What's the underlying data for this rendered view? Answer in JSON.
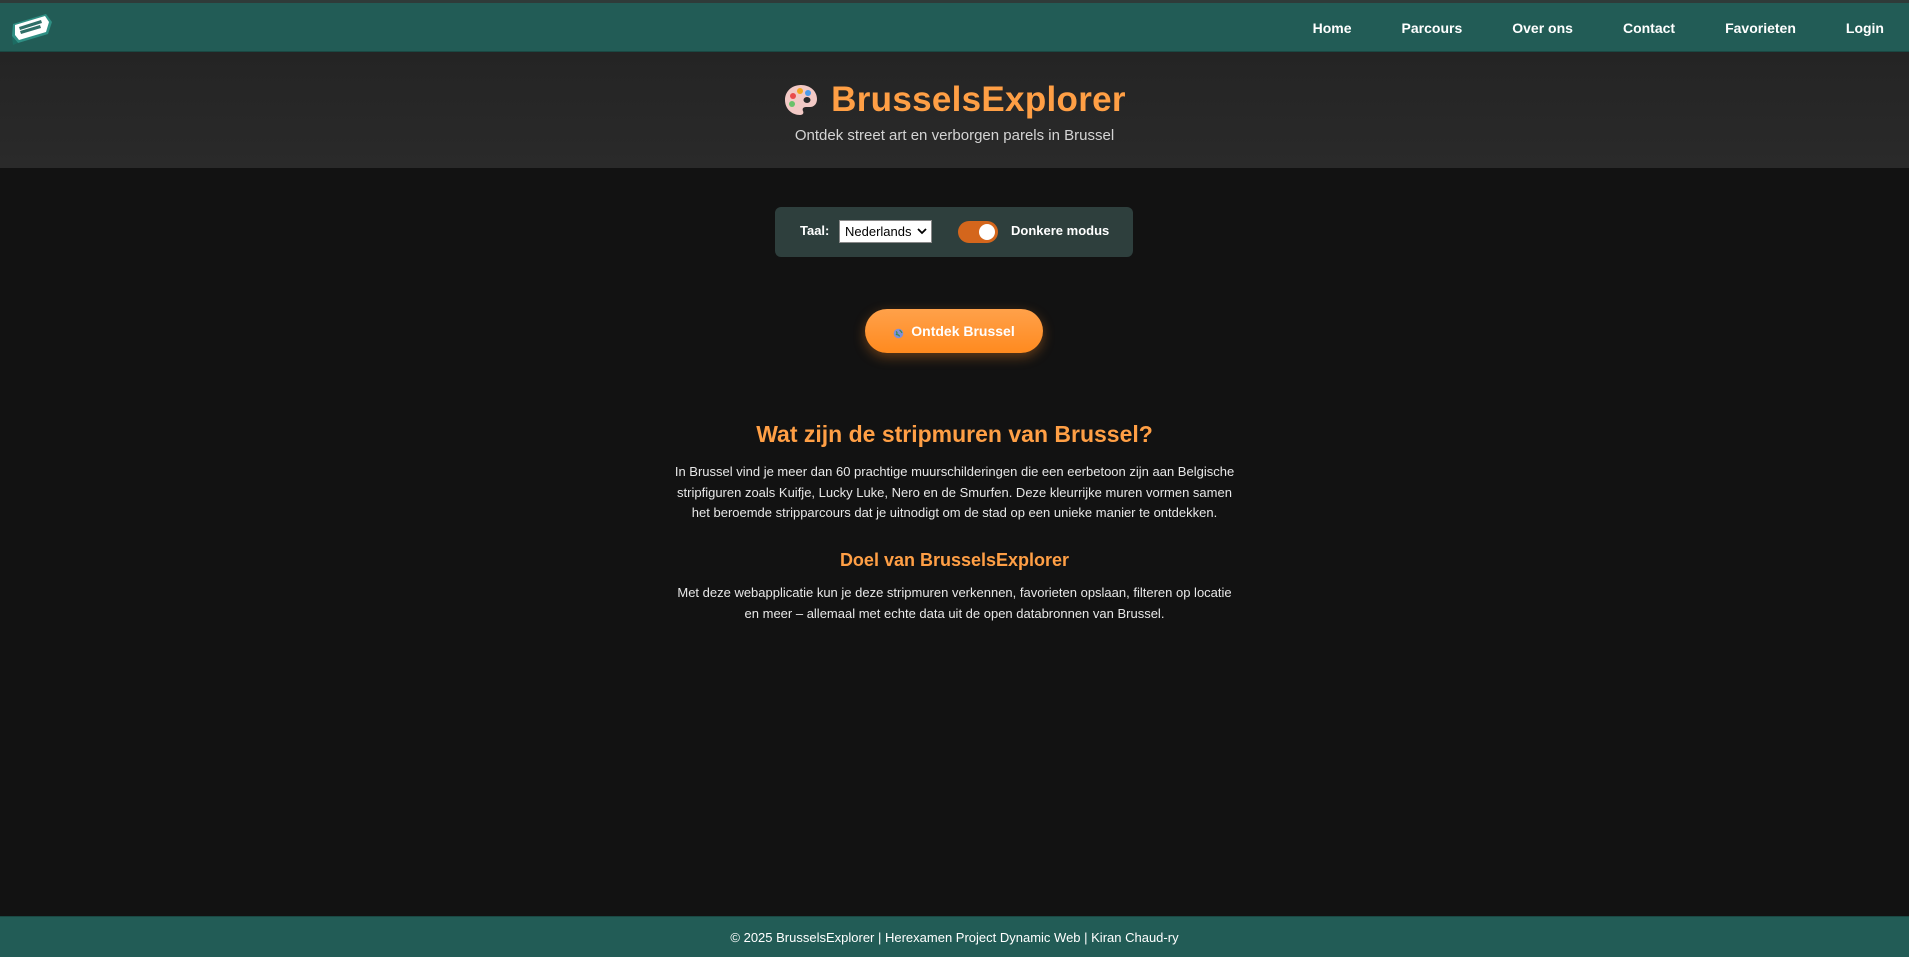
{
  "nav": {
    "logo_alt": "logo-icon",
    "links": [
      "Home",
      "Parcours",
      "Over ons",
      "Contact",
      "Favorieten",
      "Login"
    ]
  },
  "header": {
    "title": "BrusselsExplorer",
    "subtitle": "Ontdek street art en verborgen parels in Brussel",
    "icon": "palette-icon"
  },
  "settings": {
    "language_label": "Taal:",
    "language_selected": "Nederlands",
    "dark_mode_label": "Donkere modus",
    "dark_mode_on": true
  },
  "cta": {
    "label": "Ontdek Brussel",
    "icon": "globe-icon"
  },
  "content": {
    "heading": "Wat zijn de stripmuren van Brussel?",
    "intro": "In Brussel vind je meer dan 60 prachtige muurschilderingen die een eerbetoon zijn aan Belgische stripfiguren zoals Kuifje, Lucky Luke, Nero en de Smurfen. Deze kleurrijke muren vormen samen het beroemde stripparcours dat je uitnodigt om de stad op een unieke manier te ontdekken.",
    "subheading": "Doel van BrusselsExplorer",
    "goal": "Met deze webapplicatie kun je deze stripmuren verkennen, favorieten opslaan, filteren op locatie en meer – allemaal met echte data uit de open databronnen van Brussel."
  },
  "footer": {
    "text": "© 2025 BrusselsExplorer | Herexamen Project Dynamic Web | Kiran Chaud-ry"
  },
  "colors": {
    "nav_bg": "#225c56",
    "accent": "#ff9f45",
    "page_bg": "#121212",
    "toggle_on": "#d4661c"
  }
}
